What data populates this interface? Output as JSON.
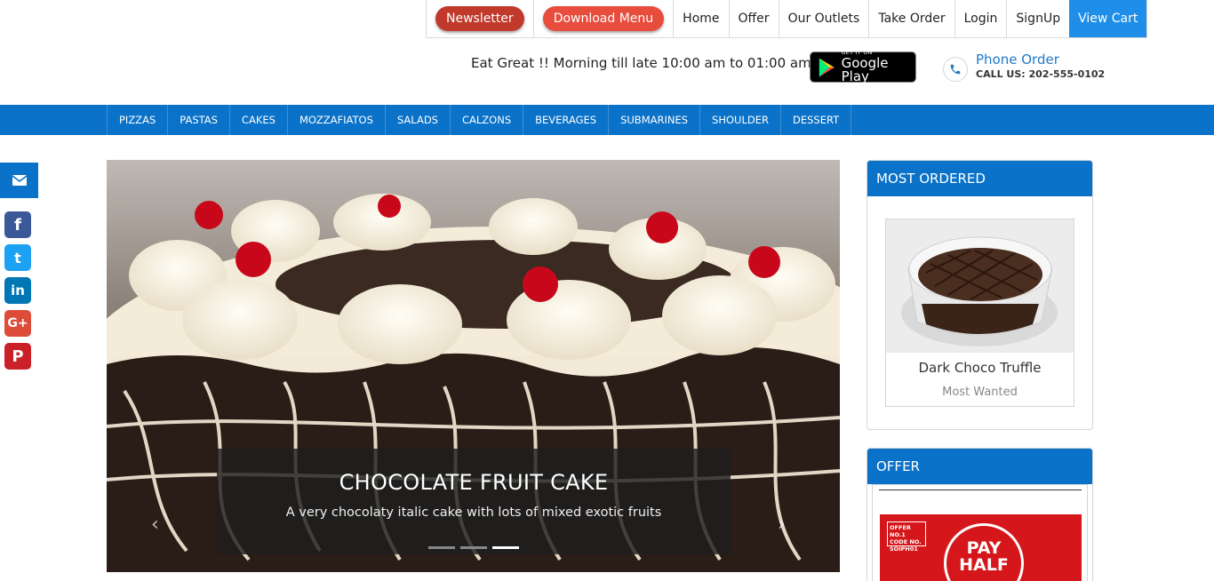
{
  "topnav": {
    "newsletter": "Newsletter",
    "download_menu": "Download Menu",
    "links": [
      "Home",
      "Offer",
      "Our Outlets",
      "Take Order",
      "Login",
      "SignUp"
    ],
    "cart": "View Cart"
  },
  "header": {
    "tagline": "Eat Great !! Morning till late 10:00 am to 01:00 am",
    "gplay_small": "GET IT ON",
    "gplay_big": "Google Play",
    "phone_title": "Phone Order",
    "phone_number": "CALL US: 202-555-0102"
  },
  "categories": [
    "PIZZAS",
    "PASTAS",
    "CAKES",
    "MOZZAFIATOS",
    "SALADS",
    "CALZONS",
    "BEVERAGES",
    "SUBMARINES",
    "SHOULDER",
    "DESSERT"
  ],
  "social": [
    {
      "name": "facebook",
      "glyph": "f",
      "color": "#3b5998"
    },
    {
      "name": "twitter",
      "glyph": "t",
      "color": "#1da1f2"
    },
    {
      "name": "linkedin",
      "glyph": "in",
      "color": "#0077b5"
    },
    {
      "name": "google-plus",
      "glyph": "G+",
      "color": "#dd4b39"
    },
    {
      "name": "pinterest",
      "glyph": "P",
      "color": "#cb2027"
    }
  ],
  "slider": {
    "title": "CHOCOLATE FRUIT CAKE",
    "subtitle": "A very chocolaty italic cake with lots of mixed exotic fruits",
    "slide_count": 3,
    "active_slide": 3
  },
  "most_ordered": {
    "heading": "MOST ORDERED",
    "product_name": "Dark Choco Truffle",
    "product_tag": "Most Wanted"
  },
  "offer": {
    "heading": "OFFER",
    "badge_line1": "OFFER NO.1",
    "badge_line2": "CODE NO.",
    "badge_line3": "SOIPH01",
    "stamp_line1": "PAY",
    "stamp_line2": "HALF"
  }
}
